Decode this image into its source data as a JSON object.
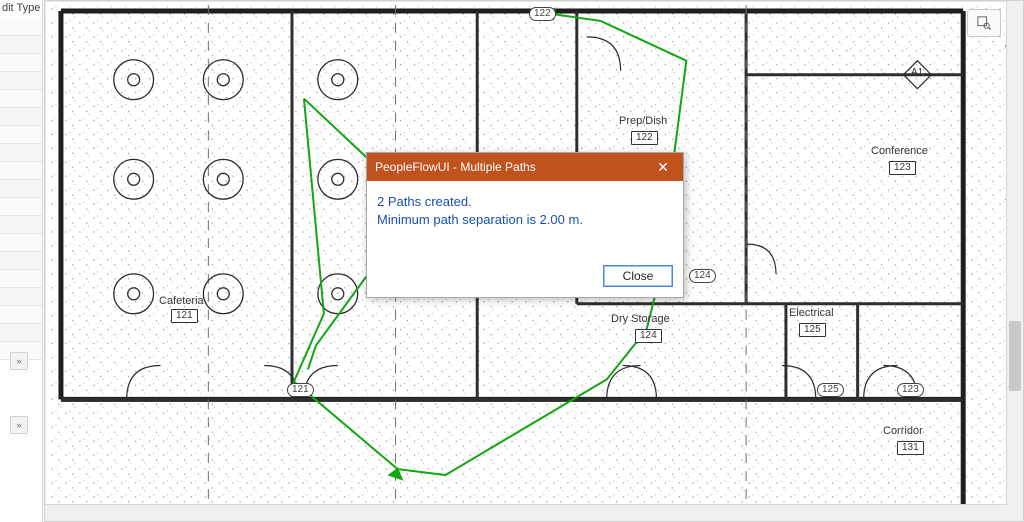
{
  "propertyPanel": {
    "header": "dit Type"
  },
  "navWidget": {
    "icon": "zoom-region-icon"
  },
  "rooms": {
    "cafeteria": {
      "name": "Cafeteria",
      "number": "121"
    },
    "prepDish": {
      "name": "Prep/Dish",
      "number": "122"
    },
    "conference": {
      "name": "Conference",
      "number": "123"
    },
    "dryStorage": {
      "name": "Dry Storage",
      "number": "124"
    },
    "electrical": {
      "name": "Electrical",
      "number": "125"
    },
    "corridor": {
      "name": "Corridor",
      "number": "131"
    }
  },
  "gridTags": {
    "col122": "122",
    "door121": "121",
    "door123": "123",
    "door124": "124",
    "door125": "125"
  },
  "marker": {
    "a1": "A1"
  },
  "dialog": {
    "title": "PeopleFlowUI - Multiple Paths",
    "message_line1": "2 Paths created.",
    "message_line2": "Minimum path separation is 2.00 m.",
    "closeLabel": "Close",
    "closeGlyph": "✕"
  }
}
